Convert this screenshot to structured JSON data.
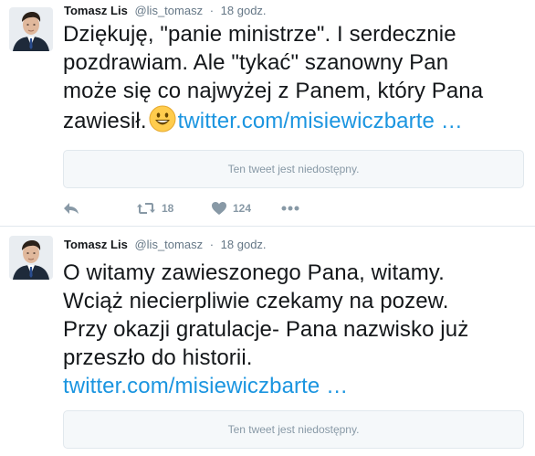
{
  "tweets": [
    {
      "author": {
        "name": "Tomasz Lis",
        "handle": "@lis_tomasz",
        "separator": "·",
        "time": "18 godz."
      },
      "text": {
        "line1": "Dziękuję, \"panie ministrze\". I serdecznie",
        "line2": "pozdrawiam. Ale \"tykać\" szanowny Pan",
        "line3": "może się co najwyżej z Panem, który Pana",
        "line4_prefix": "zawiesił.",
        "link": "twitter.com/misiewiczbarte …"
      },
      "quote": {
        "label": "Ten tweet jest niedostępny."
      },
      "actions": {
        "retweets": "18",
        "likes": "124"
      }
    },
    {
      "author": {
        "name": "Tomasz Lis",
        "handle": "@lis_tomasz",
        "separator": "·",
        "time": "18 godz."
      },
      "text": {
        "line1": "O witamy zawieszonego Pana, witamy.",
        "line2": "Wciąż niecierpliwie czekamy na pozew.",
        "line3": "Przy okazji gratulacje- Pana nazwisko już",
        "line4": "przeszło do historii.",
        "link": "twitter.com/misiewiczbarte …"
      },
      "quote": {
        "label": "Ten tweet jest niedostępny."
      }
    }
  ],
  "icons": {
    "reply": "reply-icon",
    "retweet": "retweet-icon",
    "like": "heart-icon",
    "more": "more-icon",
    "emoji": "smiley-emoji-icon"
  },
  "colors": {
    "link": "#1b95e0",
    "meta": "#657786",
    "action": "#8899a6",
    "quote_bg": "#f5f8fa",
    "border": "#e1e8ed",
    "emoji": "#ffcc4d"
  }
}
